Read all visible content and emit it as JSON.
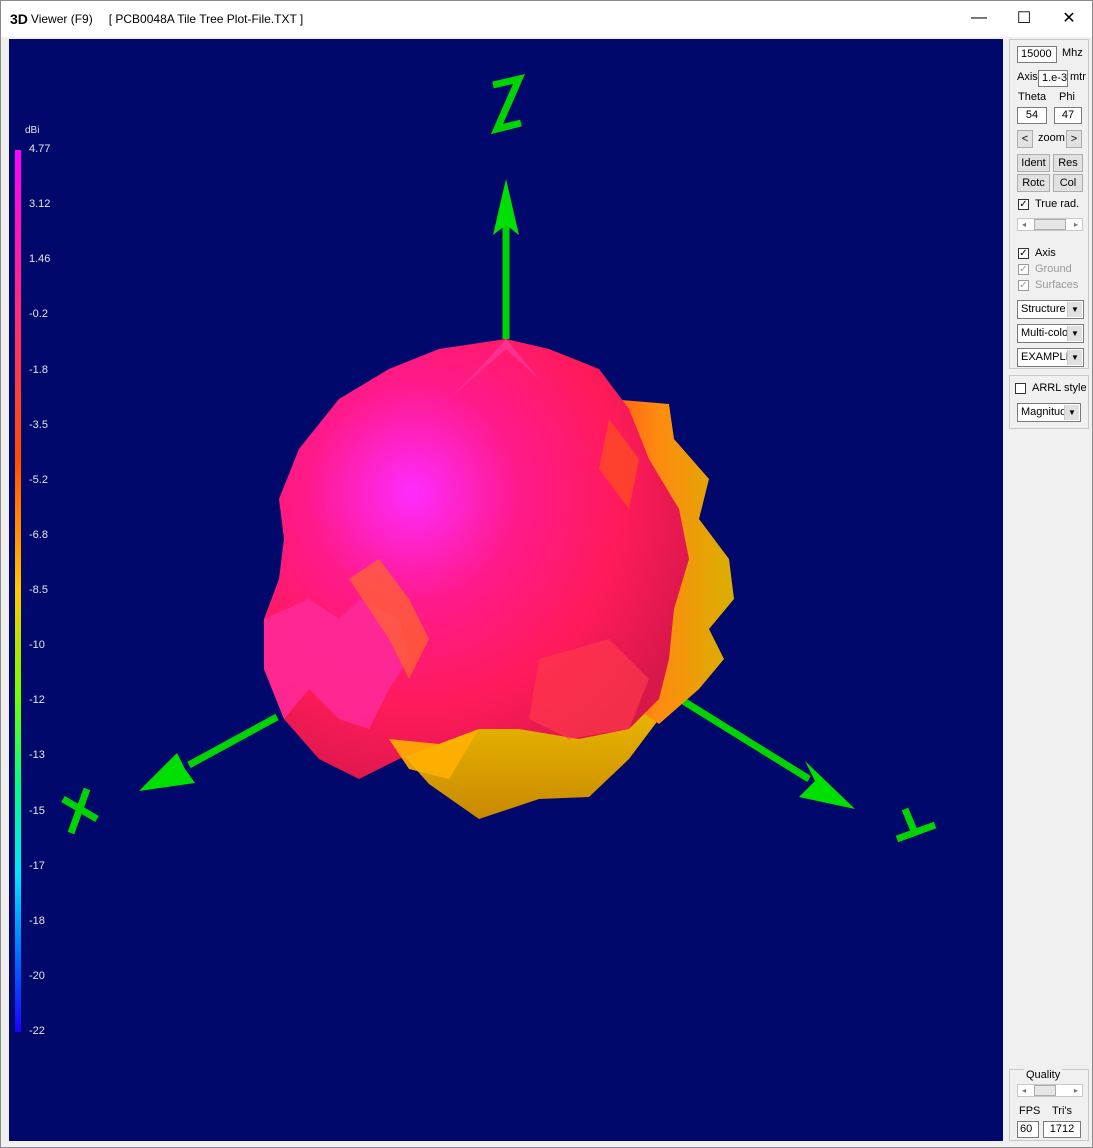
{
  "window": {
    "title_3d": "3D",
    "title_viewer": "Viewer (F9)",
    "title_file": "[ PCB0048A Tile Tree Plot-File.TXT ]",
    "minimize_glyph": "—",
    "maximize_glyph": "☐",
    "close_glyph": "✕"
  },
  "legend": {
    "unit": "dBi",
    "ticks": [
      "4.77",
      "3.12",
      "1.46",
      "-0.2",
      "-1.8",
      "-3.5",
      "-5.2",
      "-6.8",
      "-8.5",
      "-10",
      "-12",
      "-13",
      "-15",
      "-17",
      "-18",
      "-20",
      "-22"
    ]
  },
  "axes": {
    "z_label": "Z",
    "x_label": "X",
    "y_label": "Y",
    "color": "#00e000"
  },
  "panel": {
    "freq_value": "15000",
    "freq_unit": "Mhz",
    "axis_label": "Axis",
    "axis_value": "1.e-3",
    "axis_unit": "mtr",
    "theta_label": "Theta",
    "phi_label": "Phi",
    "theta_value": "54",
    "phi_value": "47",
    "zoom_left": "<",
    "zoom_label": "zoom",
    "zoom_right": ">",
    "ident_label": "Ident",
    "res_label": "Res",
    "rotc_label": "Rotc",
    "col_label": "Col",
    "true_rad_label": "True rad.",
    "axis_check_label": "Axis",
    "ground_label": "Ground",
    "surfaces_label": "Surfaces",
    "structure_option": "Structure",
    "color_option": "Multi-colo",
    "example_option": "EXAMPLI",
    "arrl_label": "ARRL style",
    "magnitude_option": "Magnitud",
    "quality_label": "Quality",
    "fps_label": "FPS",
    "tris_label": "Tri's",
    "fps_value": "60",
    "tris_value": "1712",
    "check_glyph": "✓"
  },
  "colors": {
    "viewport_bg": "#00086b",
    "pattern_magenta": "#ff1aa0",
    "pattern_orange": "#ff5a1a",
    "pattern_yellow": "#e6b800"
  }
}
